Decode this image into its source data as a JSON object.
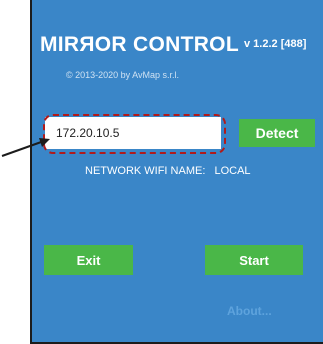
{
  "app": {
    "title": "MIRЯOR CONTROL",
    "version": "v 1.2.2 [488]",
    "copyright": "© 2013-2020 by AvMap s.r.l."
  },
  "connection": {
    "ip_value": "172.20.10.5",
    "detect_label": "Detect",
    "wifi_label": "NETWORK WIFI NAME:",
    "wifi_value": "LOCAL"
  },
  "actions": {
    "exit_label": "Exit",
    "start_label": "Start",
    "about_label": "About..."
  },
  "colors": {
    "panel_background": "#3a86c8",
    "button_green": "#4ab748",
    "highlight_red": "#b11a1a",
    "about_link": "#5ea3dd"
  },
  "icons": {
    "annotation_arrow": "arrow-pointer-icon"
  }
}
